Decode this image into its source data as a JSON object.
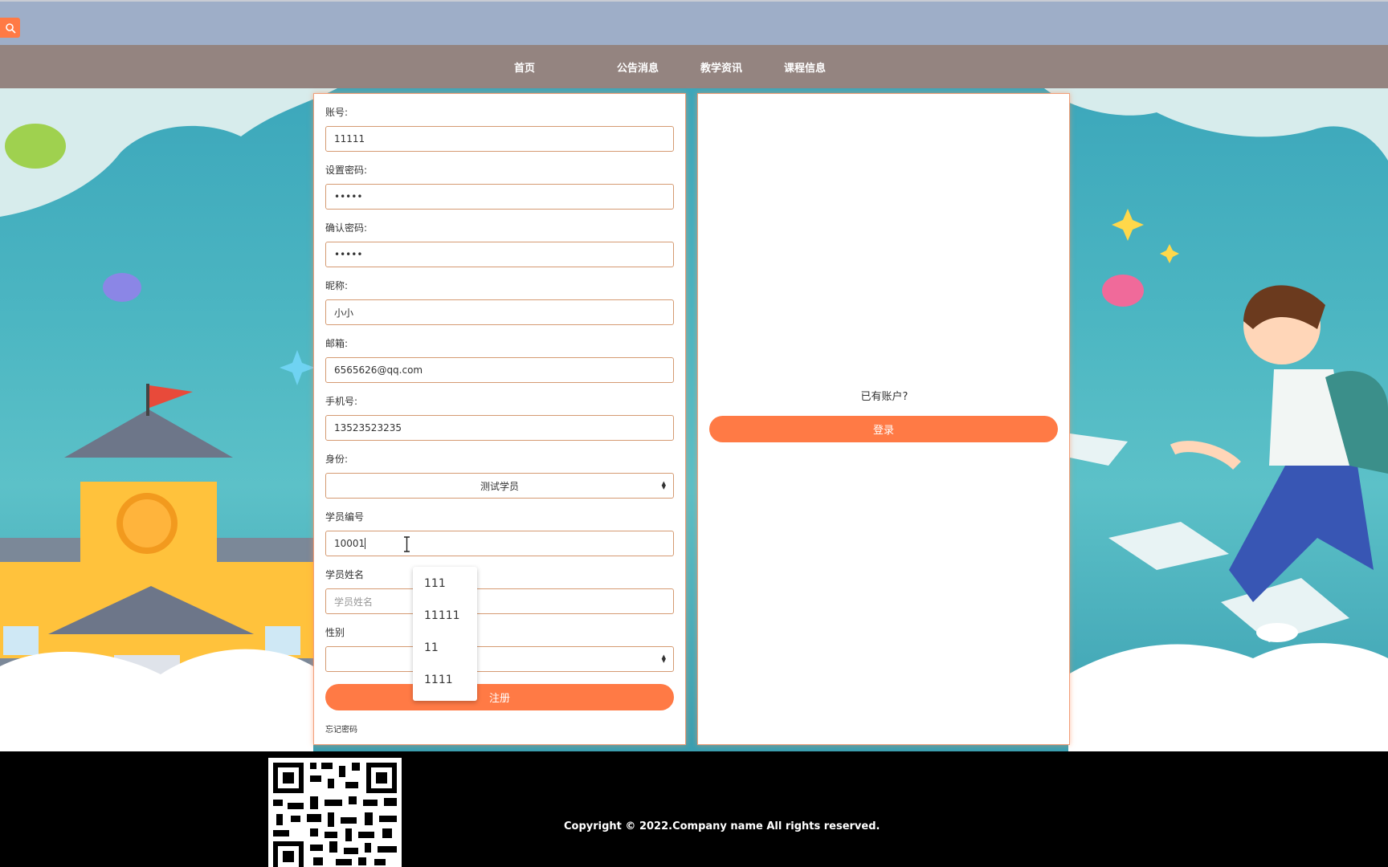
{
  "nav": {
    "items": [
      "首页",
      "公告消息",
      "教学资讯",
      "课程信息"
    ]
  },
  "form": {
    "account_label": "账号:",
    "account_value": "11111",
    "password_label": "设置密码:",
    "password_value": "•••••",
    "confirm_label": "确认密码:",
    "confirm_value": "•••••",
    "nickname_label": "昵称:",
    "nickname_value": "小小",
    "email_label": "邮箱:",
    "email_value": "6565626@qq.com",
    "phone_label": "手机号:",
    "phone_value": "13523523235",
    "identity_label": "身份:",
    "identity_value": "测试学员",
    "student_id_label": "学员编号",
    "student_id_value": "10001",
    "student_name_label": "学员姓名",
    "student_name_placeholder": "学员姓名",
    "gender_label": "性别",
    "gender_value": "",
    "register_label": "注册",
    "forgot_label": "忘记密码"
  },
  "autocomplete": [
    "111",
    "11111",
    "11",
    "1111"
  ],
  "login_panel": {
    "prompt": "已有账户?",
    "login_label": "登录"
  },
  "footer": {
    "copyright": "Copyright © 2022.Company name All rights reserved."
  },
  "colors": {
    "accent": "#ff7a45",
    "topbar": "#9eaec8",
    "navbar": "#948480"
  },
  "icons": {
    "search": "search-icon"
  }
}
